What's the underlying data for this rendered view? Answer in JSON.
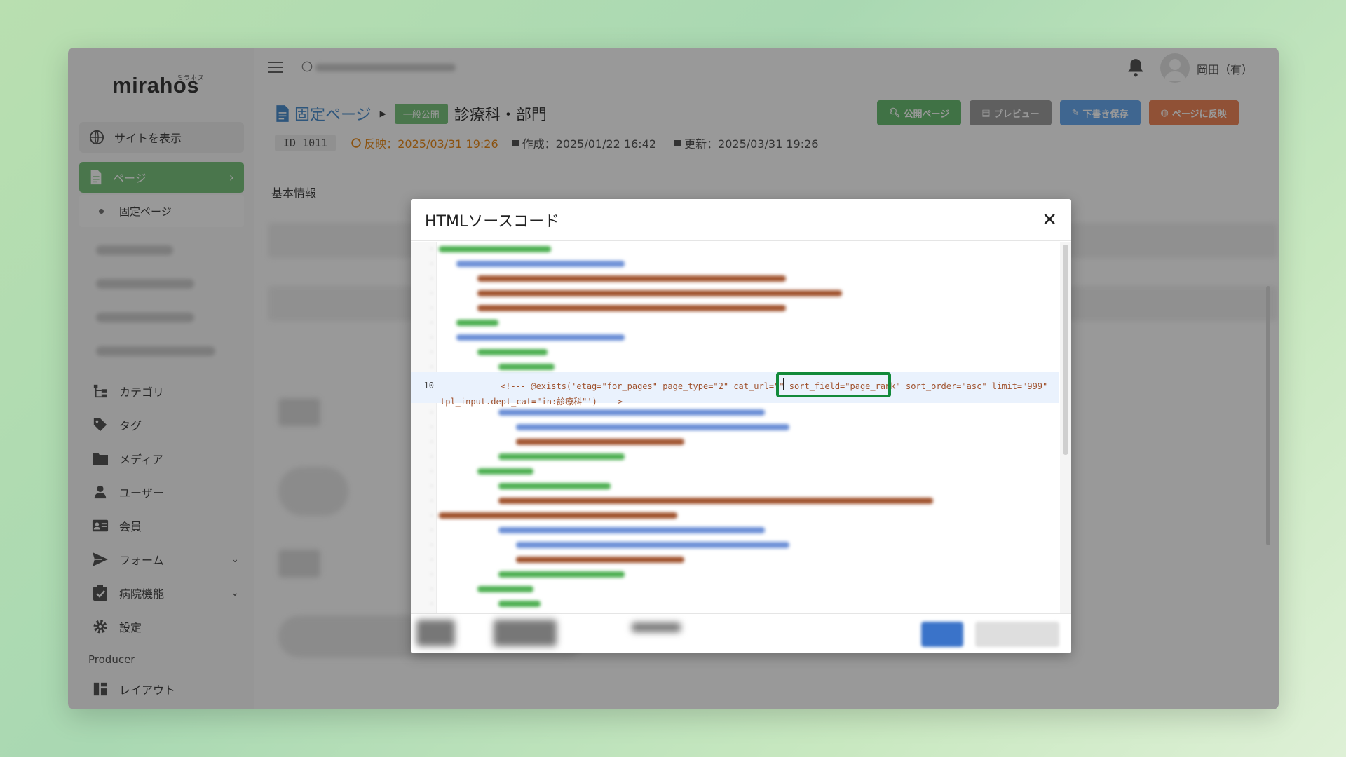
{
  "sidebar": {
    "logo": "mirahos",
    "logo_sub": "ミラホス",
    "view_site": "サイトを表示",
    "active_item": "ページ",
    "sub_item": "固定ページ",
    "items": [
      {
        "label": "カテゴリ",
        "icon": "sitemap-icon"
      },
      {
        "label": "タグ",
        "icon": "tag-icon"
      },
      {
        "label": "メディア",
        "icon": "folder-icon"
      },
      {
        "label": "ユーザー",
        "icon": "user-icon"
      },
      {
        "label": "会員",
        "icon": "id-card-icon"
      },
      {
        "label": "フォーム",
        "icon": "send-icon"
      },
      {
        "label": "病院機能",
        "icon": "clipboard-check-icon"
      },
      {
        "label": "設定",
        "icon": "gear-icon"
      }
    ],
    "section_label": "Producer",
    "layout_item": "レイアウト"
  },
  "header": {
    "username": "岡田（有）"
  },
  "page": {
    "crumb": "固定ページ",
    "badge": "一般公開",
    "title": "診療科・部門",
    "buttons": {
      "public_page": "公開ページ",
      "preview": "プレビュー",
      "save_draft": "下書き保存",
      "publish": "ページに反映"
    },
    "meta": {
      "id_label": "ID 1011",
      "published": "反映：2025/03/31 19:26",
      "created": "作成：2025/01/22 16:42",
      "updated": "更新：2025/03/31 19:26"
    },
    "tab_basic": "基本情報"
  },
  "modal": {
    "title": "HTMLソースコード",
    "close": "✕",
    "active_line_number": "10",
    "code_line_1": "<!--- @exists('etag=\"for_pages\" page_type=\"2\" cat_url=\"\" sort_field=\"page_rank\" sort_order=\"asc\" limit=\"999\"",
    "code_line_2": "tpl_input.dept_cat=\"in:診療科\"') --->"
  },
  "colors": {
    "accent_green": "#7cc57f",
    "highlight_green": "#138a3a",
    "link_blue": "#4e8fcf",
    "btn_green": "#6cbf73",
    "btn_gray": "#9e9e9e",
    "btn_blue": "#6aaaf0",
    "btn_orange": "#f0885a",
    "published_orange": "#e8891a"
  }
}
